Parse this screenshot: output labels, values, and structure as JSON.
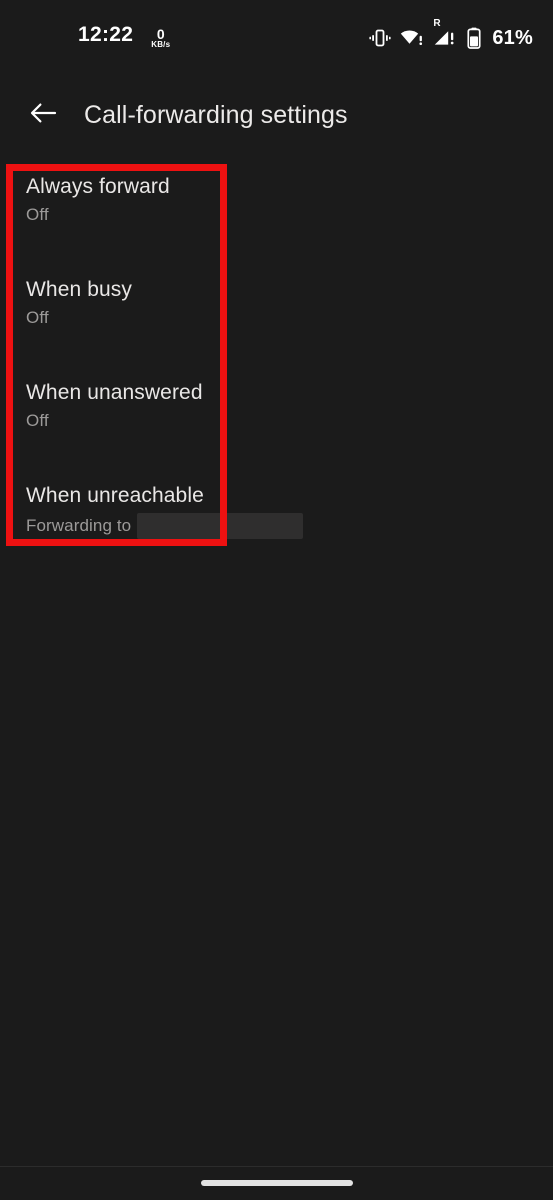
{
  "colors": {
    "background": "#1b1b1b",
    "primary_text": "#e9e7e6",
    "secondary_text": "#9c9a99",
    "annotation_red": "#ee1111",
    "redaction_block": "#2f2e2e",
    "nav_handle": "#e3e3e3"
  },
  "status_bar": {
    "clock": "12:22",
    "network_rate_value": "0",
    "network_rate_unit": "KB/s",
    "icons": [
      "vibrate-icon",
      "wifi-no-internet-icon",
      "roaming-cellular-signal-icon",
      "battery-icon"
    ],
    "roaming_label": "R",
    "battery_percent": "61%"
  },
  "app_bar": {
    "back_label": "Back",
    "title": "Call-forwarding settings"
  },
  "settings_list": {
    "items": [
      {
        "title": "Always forward",
        "subtitle": "Off",
        "redacted": false
      },
      {
        "title": "When busy",
        "subtitle": "Off",
        "redacted": false
      },
      {
        "title": "When unanswered",
        "subtitle": "Off",
        "redacted": false
      },
      {
        "title": "When unreachable",
        "subtitle": "Forwarding to",
        "redacted": true
      }
    ]
  },
  "annotation": {
    "shape": "rectangle",
    "color": "#ee1111",
    "covers": "all four call-forwarding list items"
  },
  "nav_bar": {
    "handle": "gesture-home-handle"
  }
}
